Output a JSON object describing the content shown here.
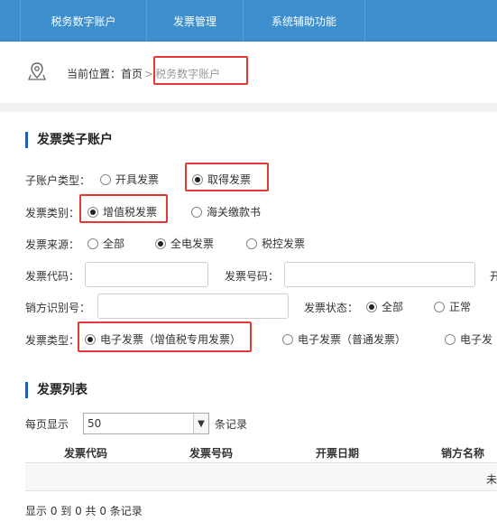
{
  "nav": {
    "items": [
      "税务数字账户",
      "发票管理",
      "系统辅助功能"
    ]
  },
  "breadcrumb": {
    "prefix": "当前位置：",
    "home": "首页",
    "separator": ">",
    "current": "税务数字账户"
  },
  "sub_account": {
    "title": "发票类子账户",
    "type_label": "子账户类型：",
    "type_options": [
      "开具发票",
      "取得发票"
    ],
    "type_selected": "取得发票",
    "category_label": "发票类别：",
    "category_options": [
      "增值税发票",
      "海关缴款书"
    ],
    "category_selected": "增值税发票",
    "source_label": "发票来源：",
    "source_options": [
      "全部",
      "全电发票",
      "税控发票"
    ],
    "source_selected": "全电发票",
    "code_label": "发票代码：",
    "number_label": "发票号码：",
    "code_value": "",
    "number_value": "",
    "trailing_label": "开",
    "seller_id_label": "销方识别号：",
    "seller_id_value": "",
    "status_label": "发票状态：",
    "status_options": [
      "全部",
      "正常"
    ],
    "status_selected": "全部",
    "kind_label": "发票类型：",
    "kind_options": [
      "电子发票（增值税专用发票）",
      "电子发票（普通发票）",
      "电子发"
    ],
    "kind_selected": "电子发票（增值税专用发票）"
  },
  "invoice_list": {
    "title": "发票列表",
    "per_page_prefix": "每页显示",
    "per_page_value": "50",
    "per_page_suffix": "条记录",
    "columns": [
      "发票代码",
      "发票号码",
      "开票日期",
      "销方名称"
    ],
    "empty_text": "未找",
    "summary": "显示 0 到 0 共 0 条记录"
  },
  "colors": {
    "nav_bg": "#3d8fce",
    "highlight": "#e53935",
    "section_bar": "#1e5fb3"
  }
}
